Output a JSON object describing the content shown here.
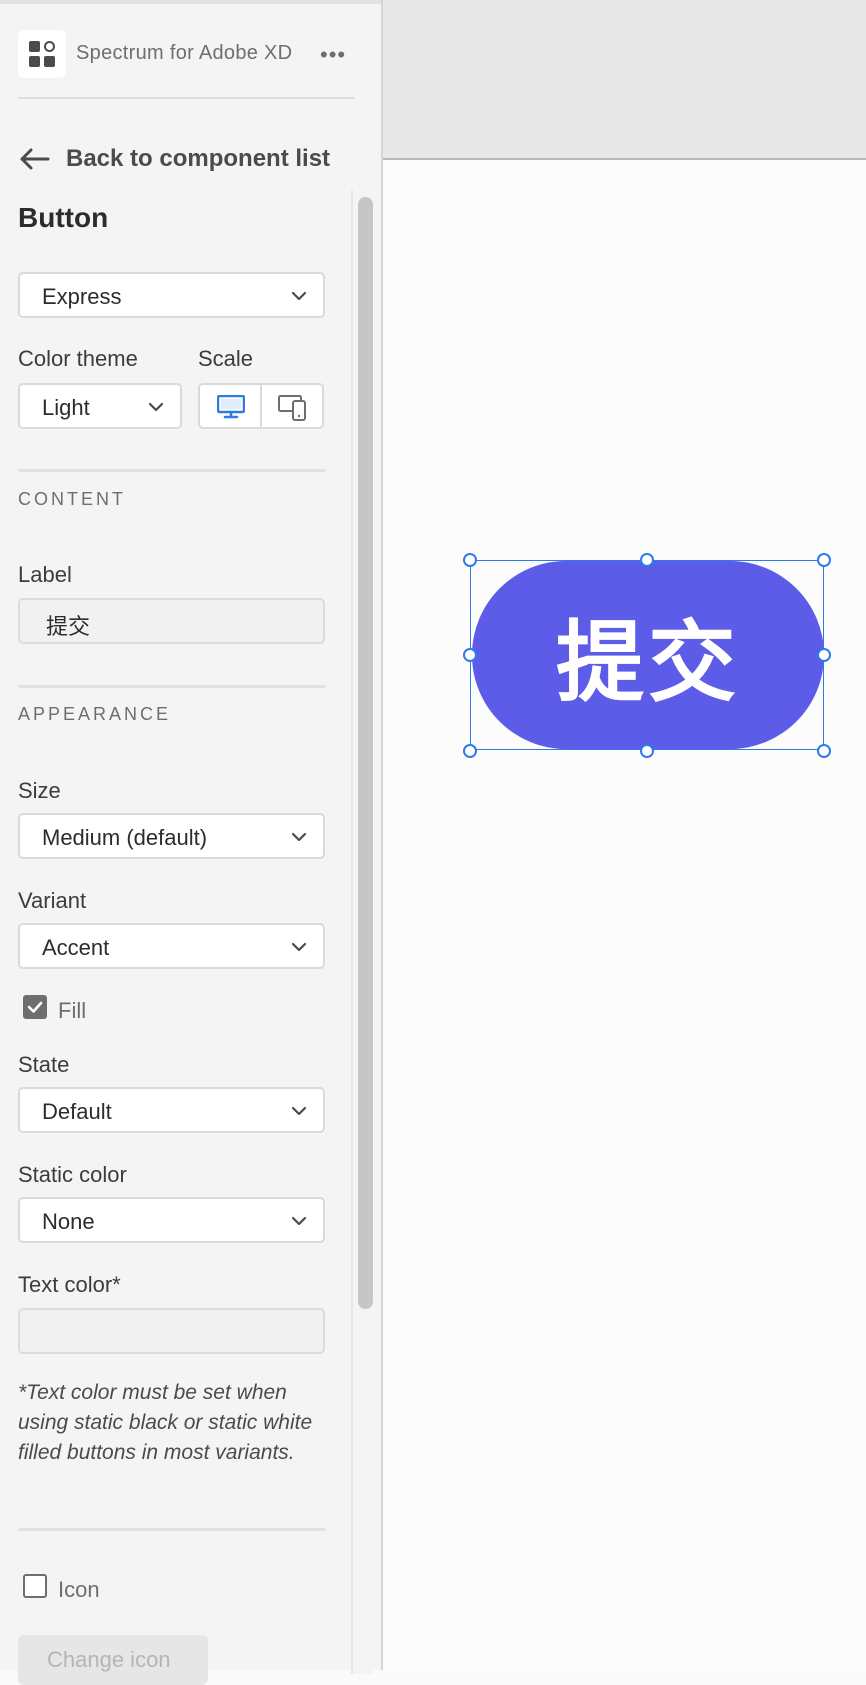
{
  "app": {
    "title": "Spectrum for Adobe XD",
    "more_icon": "•••",
    "logo_icon": "apps-grid-icon"
  },
  "nav": {
    "back_label": "Back to component list"
  },
  "component": {
    "title": "Button",
    "design_system": "Express"
  },
  "theme": {
    "color_theme_label": "Color theme",
    "color_theme_value": "Light",
    "scale_label": "Scale",
    "scale_options": [
      "desktop-icon",
      "mobile-icon"
    ],
    "scale_selected": "desktop"
  },
  "content": {
    "section_label": "CONTENT",
    "label_label": "Label",
    "label_value": "提交"
  },
  "appearance": {
    "section_label": "APPEARANCE",
    "size_label": "Size",
    "size_value": "Medium (default)",
    "variant_label": "Variant",
    "variant_value": "Accent",
    "fill_label": "Fill",
    "fill_checked": true,
    "state_label": "State",
    "state_value": "Default",
    "static_color_label": "Static color",
    "static_color_value": "None",
    "text_color_label": "Text color*",
    "text_color_value": "",
    "note": "*Text color must be set when using static black or static white filled buttons in most variants."
  },
  "icon": {
    "icon_label": "Icon",
    "icon_checked": false,
    "change_icon_label": "Change icon"
  },
  "canvas": {
    "button_label": "提交",
    "button_color": "#5c5ce8",
    "selection_color": "#2f7be6"
  }
}
